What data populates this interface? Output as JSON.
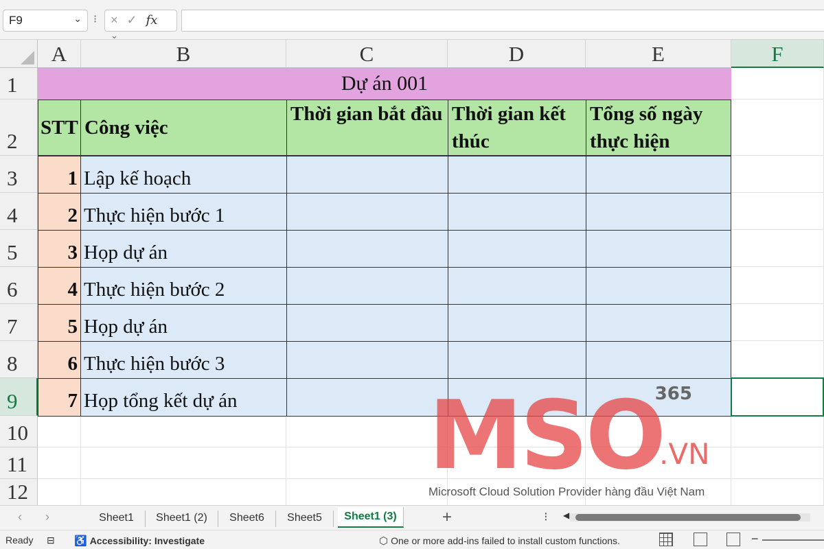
{
  "formula_bar": {
    "name_box": "F9",
    "cancel_icon": "×",
    "enter_icon": "✓",
    "fx_label": "fx",
    "formula": ""
  },
  "columns": [
    "A",
    "B",
    "C",
    "D",
    "E",
    "F"
  ],
  "rows": [
    "1",
    "2",
    "3",
    "4",
    "5",
    "6",
    "7",
    "8",
    "9",
    "10",
    "11",
    "12"
  ],
  "sheet": {
    "title": "Dự án 001",
    "headers": {
      "stt": "STT",
      "task": "Công việc",
      "start": "Thời gian bắt đầu",
      "end": "Thời gian kết thúc",
      "days": "Tổng số ngày thực hiện"
    },
    "tasks": [
      {
        "stt": "1",
        "name": "Lập kế hoạch"
      },
      {
        "stt": "2",
        "name": "Thực hiện bước 1"
      },
      {
        "stt": "3",
        "name": "Họp dự án"
      },
      {
        "stt": "4",
        "name": "Thực hiện bước 2"
      },
      {
        "stt": "5",
        "name": "Họp dự án"
      },
      {
        "stt": "6",
        "name": "Thực hiện bước 3"
      },
      {
        "stt": "7",
        "name": "Họp tổng kết dự án"
      }
    ],
    "e9_value": "365"
  },
  "watermark": {
    "logo": "MSO",
    "domain": ".VN",
    "tagline": "Microsoft Cloud Solution Provider hàng đầu Việt Nam"
  },
  "tabs": [
    {
      "label": "Sheet1",
      "active": false
    },
    {
      "label": "Sheet1 (2)",
      "active": false
    },
    {
      "label": "Sheet6",
      "active": false
    },
    {
      "label": "Sheet5",
      "active": false
    },
    {
      "label": "Sheet1 (3)",
      "active": true
    }
  ],
  "status": {
    "ready": "Ready",
    "accessibility": "Accessibility: Investigate",
    "addins": "One or more add-ins failed to install custom functions."
  },
  "colors": {
    "accent": "#107c41",
    "title_bg": "#e2a3df",
    "header_bg": "#b3e5a5",
    "stt_bg": "#fbdccb",
    "task_bg": "#dce9f7"
  }
}
